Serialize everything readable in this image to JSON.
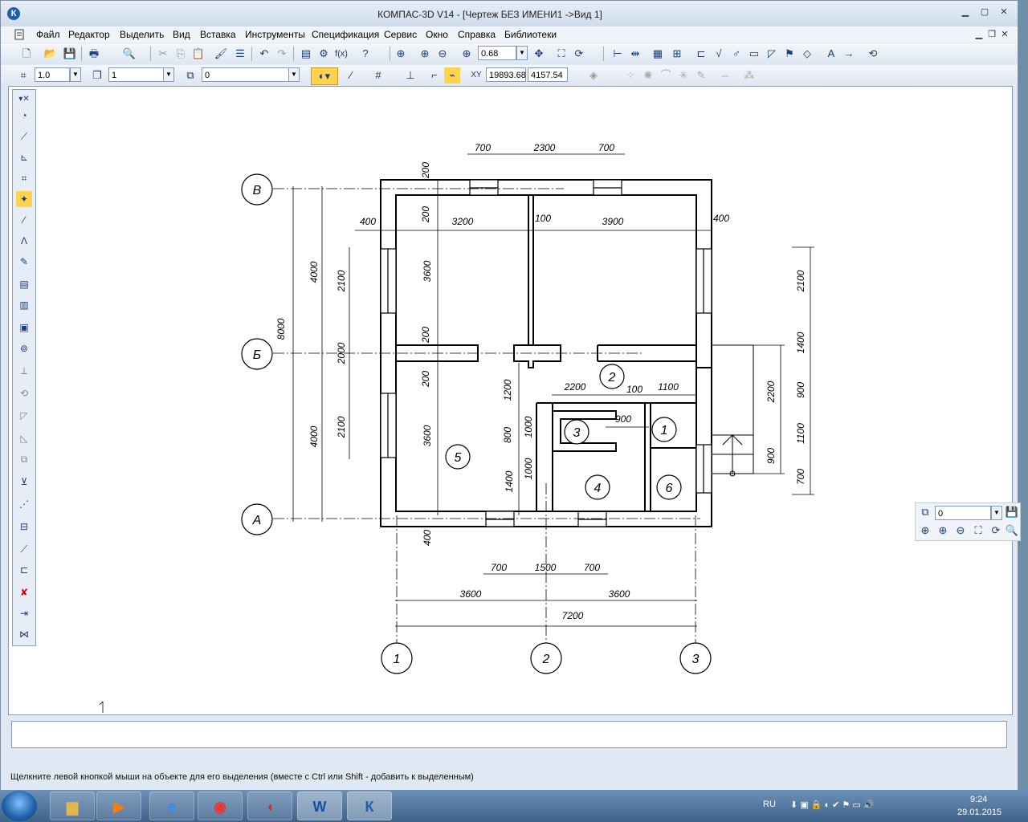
{
  "window": {
    "title": "КОМПАС-3D V14 - [Чертеж БЕЗ ИМЕНИ1 ->Вид 1]",
    "app_icon": "К"
  },
  "menu": [
    "Файл",
    "Редактор",
    "Выделить",
    "Вид",
    "Вставка",
    "Инструменты",
    "Спецификация",
    "Сервис",
    "Окно",
    "Справка",
    "Библиотеки"
  ],
  "toolbar": {
    "zoom_value": "0.68",
    "style_value": "1.0",
    "layer_value": "1",
    "state_value": "0",
    "coord_x": "19893.68",
    "coord_y": "4157.54"
  },
  "drawing": {
    "axes_letters": [
      "В",
      "Б",
      "А"
    ],
    "axes_numbers": [
      "1",
      "2",
      "3"
    ],
    "room_numbers": [
      "1",
      "2",
      "3",
      "4",
      "5",
      "6"
    ],
    "dims": {
      "top_700a": "700",
      "top_2300": "2300",
      "top_700b": "700",
      "d200_top": "200",
      "d400_left": "400",
      "d3200": "3200",
      "d100": "100",
      "d3900": "3900",
      "d400_right": "400",
      "d200_a": "200",
      "d3600_upper": "3600",
      "d200_b": "200",
      "d200_c": "200",
      "d3600_lower": "3600",
      "d4000_upper": "4000",
      "d8000": "8000",
      "d4000_lower": "4000",
      "d2100_upper": "2100",
      "d2000": "2000",
      "d2100_lower": "2100",
      "d2200": "2200",
      "d100_mid": "100",
      "d1100": "1100",
      "d900": "900",
      "d1200": "1200",
      "d800": "800",
      "d1000a": "1000",
      "d1000b": "1000",
      "d1400_l": "1400",
      "d400_bottom": "400",
      "b700a": "700",
      "b1500": "1500",
      "b700b": "700",
      "b3600a": "3600",
      "b3600b": "3600",
      "b7200": "7200",
      "r2100": "2100",
      "r1400": "1400",
      "r900": "900",
      "r1100": "1100",
      "r700": "700",
      "r2200": "2200",
      "r900b": "900"
    }
  },
  "status_text": "Щелкните левой кнопкой мыши на объекте для его выделения (вместе с Ctrl или Shift - добавить к выделенным)",
  "float_panel": {
    "layer_value": "0"
  },
  "taskbar": {
    "lang": "RU",
    "time": "9:24",
    "date": "29.01.2015",
    "apps": [
      "explorer-app",
      "media-player-app",
      "ie-app",
      "chrome-app",
      "app-red",
      "word-app",
      "kompas-app"
    ]
  }
}
